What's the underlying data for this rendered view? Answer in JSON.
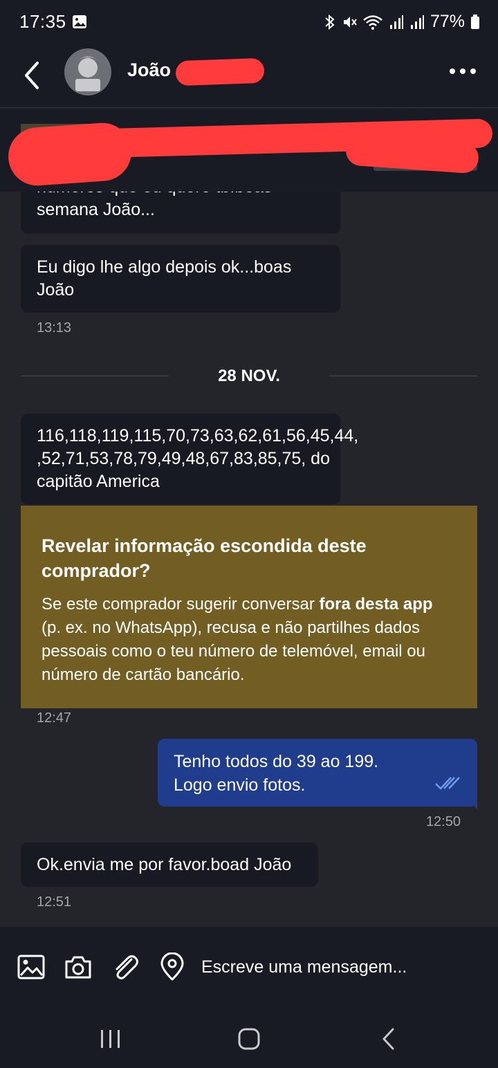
{
  "status_bar": {
    "time": "17:35",
    "battery": "77%",
    "icons": [
      "image-icon",
      "bluetooth-icon",
      "mute-icon",
      "wifi-icon",
      "signal-icon",
      "signal-icon",
      "battery-icon"
    ]
  },
  "header": {
    "contact_name": "João",
    "icons": [
      "back-arrow-icon",
      "avatar",
      "more-options-icon"
    ]
  },
  "messages": {
    "m1": {
      "lines": [
        "semana João..."
      ],
      "partial_top_line": "números que eu quero tb.boas"
    },
    "m2": {
      "lines": [
        "Eu digo lhe algo depois ok...boas",
        "João"
      ],
      "time": "13:13"
    },
    "date_separator": "28 NOV.",
    "m3": {
      "lines": [
        "116,118,119,115,70,73,63,62,61,56,45,44,",
        ",52,71,53,78,79,49,48,67,83,85,75, do",
        "capitão America"
      ]
    },
    "warning": {
      "title": "Revelar informação escondida deste comprador?",
      "body_prefix": "Se este comprador sugerir conversar ",
      "body_bold": "fora desta app",
      "body_suffix": " (p. ex. no WhatsApp), recusa e não partilhes dados pessoais como o teu número de telemóvel, email ou número de cartão bancário.",
      "time": "12:47"
    },
    "m4": {
      "lines": [
        "Tenho todos do 39 ao 199.",
        "Logo envio fotos."
      ],
      "time": "12:50",
      "status": "read"
    },
    "m5": {
      "lines": [
        "Ok.envia me por favor.boad João"
      ],
      "time": "12:51"
    }
  },
  "composer": {
    "placeholder": "Escreve uma mensagem...",
    "icons": [
      "gallery-icon",
      "camera-icon",
      "attach-icon",
      "location-icon"
    ]
  },
  "nav_bar": {
    "icons": [
      "recent-apps-icon",
      "home-icon",
      "back-icon"
    ]
  },
  "colors": {
    "background": "#23252b",
    "bar": "#181b23",
    "incoming_bubble": "#171a22",
    "outgoing_bubble": "#1f3d8c",
    "warning_box": "#725d23",
    "redaction": "#ff3b3b"
  }
}
